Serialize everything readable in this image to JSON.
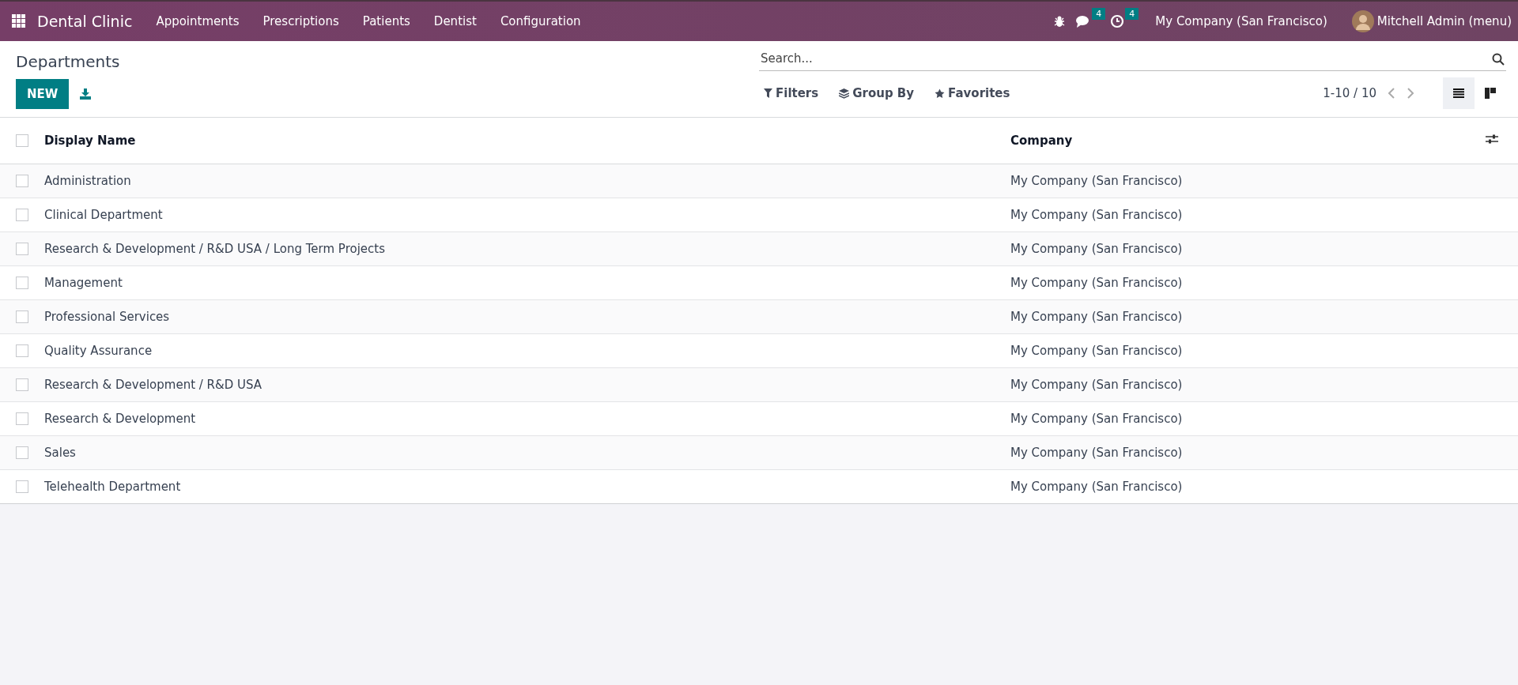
{
  "navbar": {
    "app_name": "Dental Clinic",
    "menus": [
      "Appointments",
      "Prescriptions",
      "Patients",
      "Dentist",
      "Configuration"
    ],
    "messages_count": "4",
    "activities_count": "4",
    "company": "My Company (San Francisco)",
    "user": "Mitchell Admin (menu)"
  },
  "page": {
    "title": "Departments",
    "new_button": "NEW"
  },
  "search": {
    "placeholder": "Search..."
  },
  "search_options": [
    "Filters",
    "Group By",
    "Favorites"
  ],
  "pager": "1-10 / 10",
  "views": [
    {
      "kind": "list",
      "selected": true
    },
    {
      "kind": "kanban",
      "selected": false
    }
  ],
  "table": {
    "select_all_checked": false,
    "columns": [
      "Display Name",
      "Company"
    ],
    "rows": [
      {
        "name": "Administration",
        "company": "My Company (San Francisco)",
        "checked": false
      },
      {
        "name": "Clinical Department",
        "company": "My Company (San Francisco)",
        "checked": false
      },
      {
        "name": "Research & Development / R&D USA / Long Term Projects",
        "company": "My Company (San Francisco)",
        "checked": false
      },
      {
        "name": "Management",
        "company": "My Company (San Francisco)",
        "checked": false
      },
      {
        "name": "Professional Services",
        "company": "My Company (San Francisco)",
        "checked": false
      },
      {
        "name": "Quality Assurance",
        "company": "My Company (San Francisco)",
        "checked": false
      },
      {
        "name": "Research & Development / R&D USA",
        "company": "My Company (San Francisco)",
        "checked": false
      },
      {
        "name": "Research & Development",
        "company": "My Company (San Francisco)",
        "checked": false
      },
      {
        "name": "Sales",
        "company": "My Company (San Francisco)",
        "checked": false
      },
      {
        "name": "Telehealth Department",
        "company": "My Company (San Francisco)",
        "checked": false
      }
    ]
  }
}
